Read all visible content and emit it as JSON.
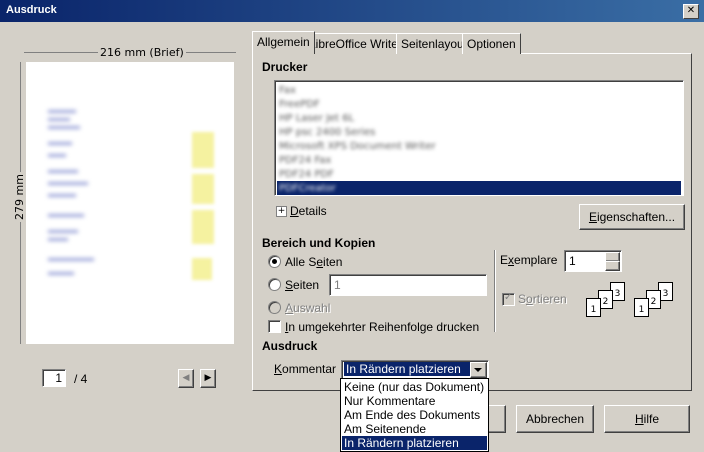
{
  "window": {
    "title": "Ausdruck",
    "close_glyph": "✕"
  },
  "preview": {
    "width_label": "216 mm (Brief)",
    "height_label": "279 mm",
    "page_value": "1",
    "page_total": "/ 4",
    "prev_glyph": "◀",
    "next_glyph": "▶"
  },
  "tabs": [
    {
      "label": "Allgemein",
      "active": true
    },
    {
      "label": "LibreOffice Writer"
    },
    {
      "label": "Seitenlayout"
    },
    {
      "label": "Optionen"
    }
  ],
  "printer": {
    "section_label": "Drucker",
    "items": [
      "Fax",
      "FreePDF",
      "HP Laser Jet 6L",
      "HP psc 2400 Series",
      "Microsoft XPS Document Writer",
      "PDF24 Fax",
      "PDF24 PDF",
      "PDFCreator"
    ],
    "selected_index": 7,
    "details_expander": "+",
    "details_label": "Details",
    "properties_button": "Eigenschaften..."
  },
  "range": {
    "section_label": "Bereich und Kopien",
    "all_pages_label": "Alle Seiten",
    "pages_label": "Seiten",
    "pages_value": "1",
    "selection_label": "Auswahl",
    "reverse_label": "In umgekehrter Reihenfolge drucken",
    "copies_label": "Exemplare",
    "copies_value": "1",
    "collate_label": "Sortieren",
    "collate_checked": true
  },
  "output": {
    "section_label": "Ausdruck",
    "comments_label": "Kommentar",
    "comments_value": "In Rändern platzieren",
    "options": [
      "Keine (nur das Dokument)",
      "Nur Kommentare",
      "Am Ende des Dokuments",
      "Am Seitenende",
      "In Rändern platzieren"
    ],
    "selected_index": 4
  },
  "buttons": {
    "cancel": "Abbrechen",
    "help": "Hilfe"
  }
}
